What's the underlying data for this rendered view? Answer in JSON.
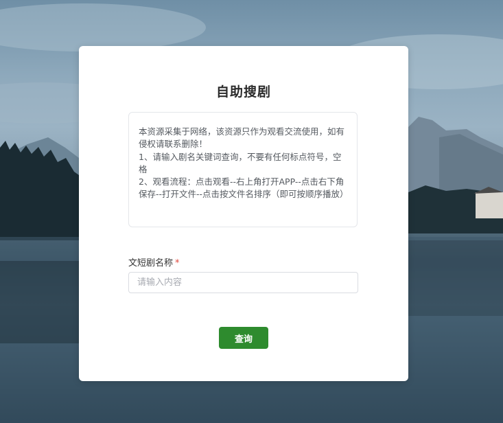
{
  "form": {
    "title": "自助搜剧",
    "notice_lines": [
      "本资源采集于网络，该资源只作为观看交流使用，如有侵权请联系删除！",
      "1、请输入剧名关键词查询，不要有任何标点符号，空格",
      "2、观看流程：点击观看--右上角打开APP--点击右下角保存--打开文件--点击按文件名排序（即可按顺序播放）"
    ],
    "field_label": "文短剧名称",
    "required_mark": "*",
    "input_placeholder": "请输入内容",
    "input_value": "",
    "submit_label": "查询"
  },
  "colors": {
    "button": "#2e8b2e",
    "required": "#e0473c"
  }
}
